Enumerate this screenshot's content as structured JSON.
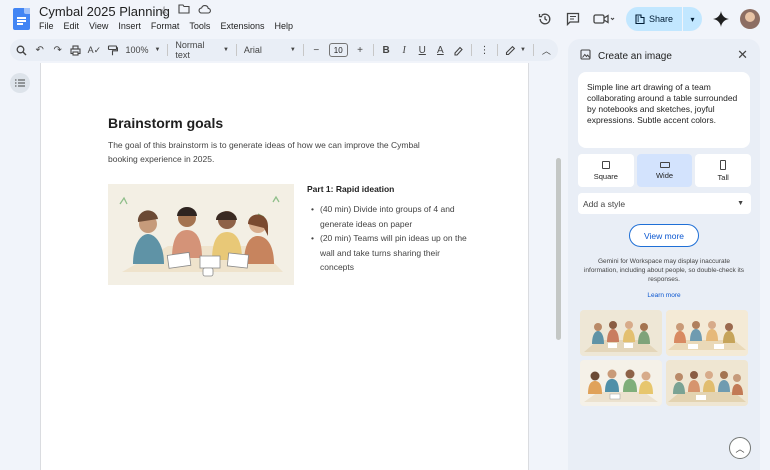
{
  "app": {
    "doc_title": "Cymbal 2025 Planning",
    "logo_icon": "google-docs-icon",
    "title_icons": [
      "star-icon",
      "move-folder-icon",
      "cloud-saved-icon"
    ]
  },
  "menu": [
    "File",
    "Edit",
    "View",
    "Insert",
    "Format",
    "Tools",
    "Extensions",
    "Help"
  ],
  "header_actions": {
    "share_label": "Share",
    "icons": [
      "version-history-icon",
      "comments-icon",
      "meet-icon",
      "gemini-icon",
      "avatar"
    ]
  },
  "toolbar": {
    "zoom": "100%",
    "style": "Normal text",
    "font": "Arial",
    "font_size": "10"
  },
  "document": {
    "heading": "Brainstorm goals",
    "intro": "The goal of this brainstorm is to generate ideas of how we can improve the Cymbal booking experience in 2025.",
    "part_title": "Part 1: Rapid ideation",
    "bullets": [
      "(40 min) Divide into groups of 4 and generate ideas on paper",
      "(20 min) Teams will pin ideas up on the wall and take turns sharing their concepts"
    ]
  },
  "panel": {
    "title": "Create an image",
    "prompt": "Simple line art drawing of a team collaborating around a table surrounded by notebooks and sketches, joyful expressions. Subtle accent colors.",
    "aspects": [
      {
        "label": "Square",
        "selected": false
      },
      {
        "label": "Wide",
        "selected": true
      },
      {
        "label": "Tall",
        "selected": false
      }
    ],
    "style_placeholder": "Add a style",
    "view_more": "View more",
    "disclaimer": "Gemini for Workspace may display inaccurate information, including about people, so double-check its responses.",
    "learn_more": "Learn more",
    "generated_images": [
      "team-illustration-1",
      "team-illustration-2",
      "team-illustration-3",
      "team-illustration-4"
    ]
  },
  "colors": {
    "accent": "#0b57d0",
    "share_bg": "#c2e7ff",
    "selected_aspect": "#d3e3fd",
    "panel_bg": "#e9eef6",
    "doc_blue": "#4285f4"
  }
}
